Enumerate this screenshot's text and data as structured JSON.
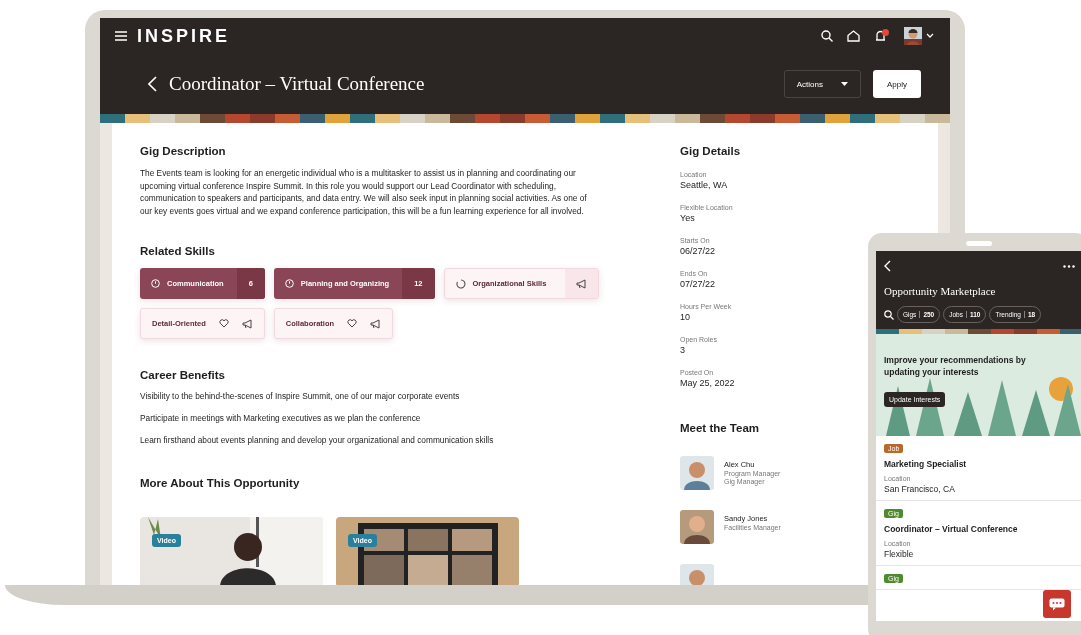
{
  "laptop": {
    "app_name": "INSPIRE",
    "title": "Coordinator – Virtual Conference",
    "actions_button": "Actions",
    "apply_button": "Apply",
    "gig_description": {
      "heading": "Gig Description",
      "text": "The Events team is looking for an energetic individual who is a multitasker to assist us in planning and coordinating our upcoming virtual conference Inspire Summit. In this role you would support our Lead Coordinator with scheduling, communication to speakers and participants, and data entry. We will also seek input in planning social activities. As one of our key events goes virtual and we expand conference participation, this will be a fun learning experience for all involved."
    },
    "related_skills": {
      "heading": "Related Skills",
      "skills": [
        {
          "label": "Communication",
          "kind": "ranked",
          "selected": true,
          "count": "6"
        },
        {
          "label": "Planning and Organizing",
          "kind": "ranked",
          "selected": true,
          "count": "12"
        },
        {
          "label": "Organizational Skills",
          "kind": "pending",
          "selected": false
        },
        {
          "label": "Detail-Oriented",
          "kind": "basic",
          "selected": false
        },
        {
          "label": "Collaboration",
          "kind": "basic",
          "selected": false
        }
      ]
    },
    "career_benefits": {
      "heading": "Career Benefits",
      "items": [
        "Visibility to the behind-the-scenes of Inspire Summit, one of our major corporate events",
        "Participate in meetings with Marketing executives as we plan the conference",
        "Learn firsthand about events planning and develop your organizational and communication skills"
      ]
    },
    "more_about": {
      "heading": "More About This Opportunity",
      "media": [
        {
          "badge": "Video",
          "kind": "picture"
        },
        {
          "badge": "Video",
          "kind": "picture"
        }
      ]
    },
    "gig_details": {
      "heading": "Gig Details",
      "fields": [
        {
          "label": "Location",
          "value": "Seattle, WA"
        },
        {
          "label": "Flexible Location",
          "value": "Yes"
        },
        {
          "label": "Starts On",
          "value": "06/27/22"
        },
        {
          "label": "Ends On",
          "value": "07/27/22"
        },
        {
          "label": "Hours Per Week",
          "value": "10"
        },
        {
          "label": "Open Roles",
          "value": "3"
        },
        {
          "label": "Posted On",
          "value": "May 25, 2022"
        }
      ]
    },
    "team": {
      "heading": "Meet the Team",
      "members": [
        {
          "name": "Alex Chu",
          "roles": [
            "Program Manager",
            "Gig Manager"
          ]
        },
        {
          "name": "Sandy Jones",
          "roles": [
            "Facilities Manager"
          ]
        },
        {
          "kind": "picture"
        }
      ]
    }
  },
  "phone": {
    "title": "Opportunity Marketplace",
    "filters": [
      {
        "label": "Gigs",
        "count": "250"
      },
      {
        "label": "Jobs",
        "count": "110"
      },
      {
        "label": "Trending",
        "count": "18"
      }
    ],
    "banner": {
      "text": "Improve your recommendations by updating your interests",
      "button": "Update Interests"
    },
    "cards": [
      {
        "tag": "Job",
        "color": "#b8682a",
        "title": "Marketing Specialist",
        "field_label": "Location",
        "field_value": "San Francisco, CA"
      },
      {
        "tag": "Gig",
        "color": "#4f8a2e",
        "title": "Coordinator – Virtual Conference",
        "field_label": "Location",
        "field_value": "Flexible"
      },
      {
        "tag": "Gig",
        "color": "#4f8a2e"
      }
    ]
  }
}
